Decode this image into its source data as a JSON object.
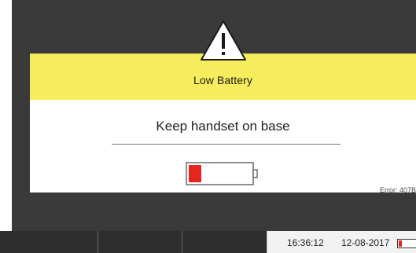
{
  "dialog": {
    "title": "Low Battery",
    "message": "Keep handset on base",
    "error": "Error: 407B",
    "battery_level_percent": 20
  },
  "status_bar": {
    "time": "16:36:12",
    "date": "12-08-2017"
  },
  "icons": {
    "warning": "warning-triangle-icon",
    "battery": "battery-low-icon",
    "status_battery": "battery-icon"
  },
  "colors": {
    "header_yellow": "#f7ec5c",
    "battery_red": "#e8251f",
    "background_dark": "#3a3a3a"
  }
}
